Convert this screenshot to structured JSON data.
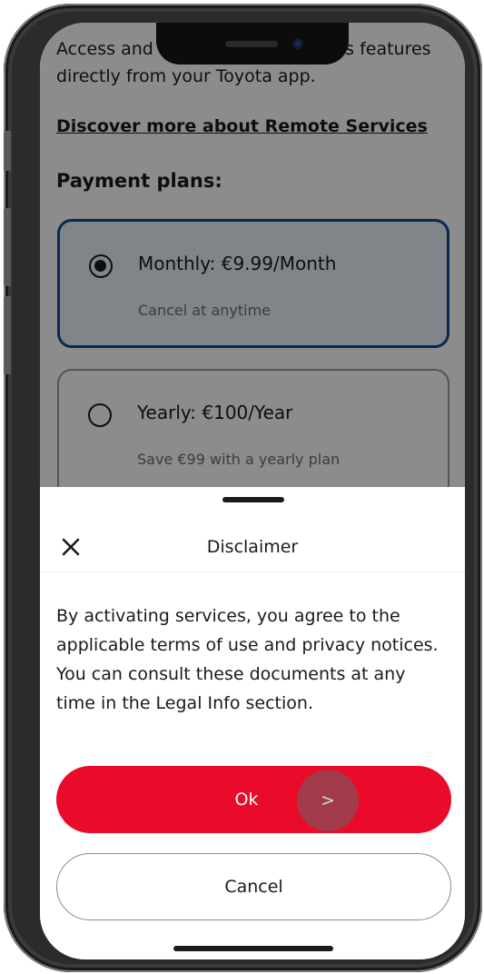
{
  "app": {
    "intro_text": "Access and manage your vehicle's features directly from your Toyota app.",
    "discover_link": "Discover more about Remote Services",
    "plans_title": "Payment plans:",
    "plans": [
      {
        "name": "Monthly: €9.99/Month",
        "subtitle": "Cancel at anytime",
        "selected": true
      },
      {
        "name": "Yearly: €100/Year",
        "subtitle": "Save €99 with a yearly plan",
        "selected": false
      }
    ]
  },
  "sheet": {
    "title": "Disclaimer",
    "close_icon": "close-icon",
    "body": "By activating services, you agree to the applicable terms of use and privacy notices. You can consult these documents at any time in the Legal Info section.",
    "ok_label": "Ok",
    "cancel_label": "Cancel",
    "touch_marker": ">"
  },
  "colors": {
    "primary_red": "#ea0a2a",
    "selected_border": "#0d4f8a",
    "selected_bg": "#e9f3fb"
  }
}
